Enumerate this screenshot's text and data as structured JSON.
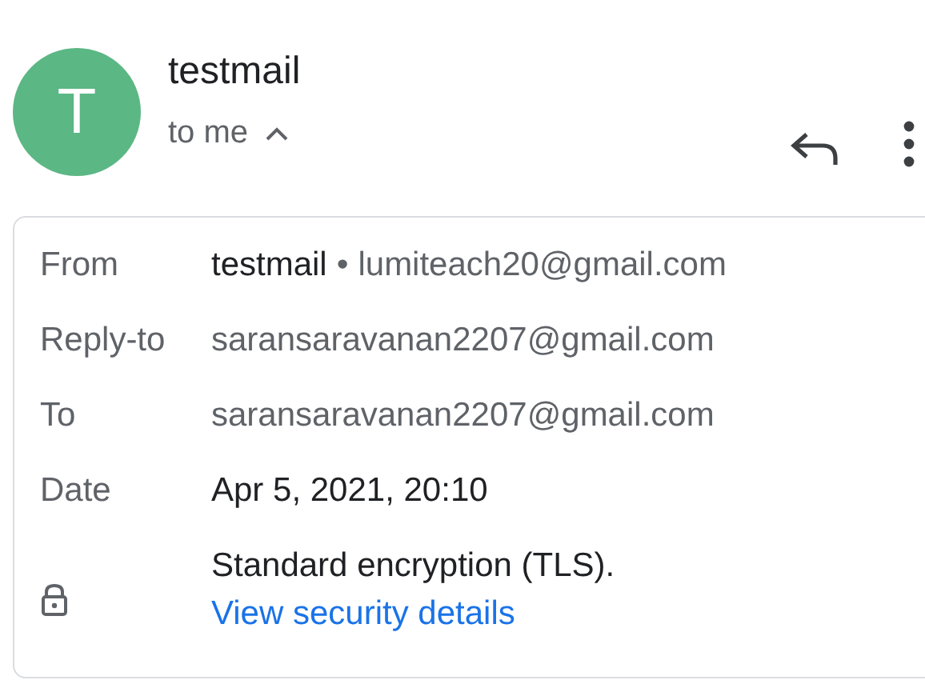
{
  "sender": {
    "initial": "T",
    "name": "testmail",
    "recipient_line": "to me",
    "expanded": true
  },
  "details": {
    "rows": [
      {
        "kind": "from",
        "label": "From",
        "name": "testmail",
        "separator": "•",
        "value": "lumiteach20@gmail.com"
      },
      {
        "kind": "plain",
        "label": "Reply-to",
        "value": "saransaravanan2207@gmail.com"
      },
      {
        "kind": "plain",
        "label": "To",
        "value": "saransaravanan2207@gmail.com"
      },
      {
        "kind": "date",
        "label": "Date",
        "value": "Apr 5, 2021, 20:10"
      },
      {
        "kind": "security",
        "value": "Standard encryption (TLS).",
        "link": "View security details"
      }
    ]
  }
}
